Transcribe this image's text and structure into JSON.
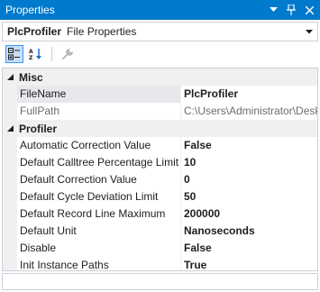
{
  "window": {
    "title": "Properties"
  },
  "selector": {
    "object_name": "PlcProfiler",
    "object_type": "File Properties"
  },
  "toolbar": {
    "categorized": "categorized-icon",
    "alphabetical": "alphabetical-icon",
    "property_pages": "wrench-icon"
  },
  "categories": [
    {
      "label": "Misc",
      "properties": [
        {
          "name": "FileName",
          "value": "PlcProfiler",
          "readonly": false
        },
        {
          "name": "FullPath",
          "value": "C:\\Users\\Administrator\\Desk",
          "readonly": true
        }
      ]
    },
    {
      "label": "Profiler",
      "properties": [
        {
          "name": "Automatic Correction Value",
          "value": "False",
          "readonly": false
        },
        {
          "name": "Default Calltree Percentage Limit",
          "value": "10",
          "readonly": false
        },
        {
          "name": "Default Correction Value",
          "value": "0",
          "readonly": false
        },
        {
          "name": "Default Cycle Deviation Limit",
          "value": "50",
          "readonly": false
        },
        {
          "name": "Default Record Line Maximum",
          "value": "200000",
          "readonly": false
        },
        {
          "name": "Default Unit",
          "value": "Nanoseconds",
          "readonly": false
        },
        {
          "name": "Disable",
          "value": "False",
          "readonly": false
        },
        {
          "name": "Init Instance Paths",
          "value": "True",
          "readonly": false
        }
      ]
    }
  ],
  "colors": {
    "titlebar": "#007acc",
    "category_bg": "#f0f0f0",
    "border": "#cccedb"
  }
}
